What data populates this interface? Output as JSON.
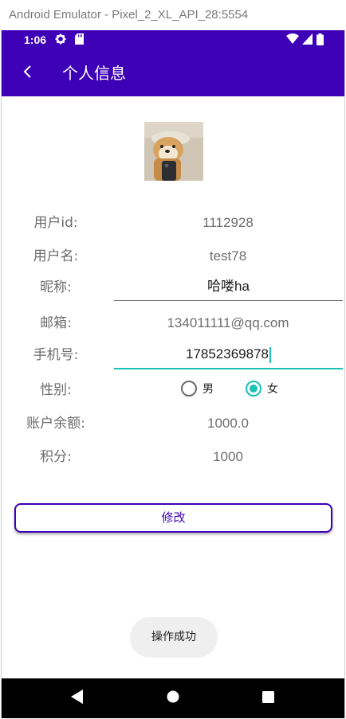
{
  "window": {
    "title": "Android Emulator - Pixel_2_XL_API_28:5554"
  },
  "status_bar": {
    "time": "1:06",
    "left_icons": [
      "gear-icon",
      "sd-card-icon"
    ],
    "right_icons": [
      "wifi-icon",
      "signal-icon",
      "battery-icon"
    ]
  },
  "app_bar": {
    "title": "个人信息",
    "back_icon": "back-arrow-icon"
  },
  "avatar": {
    "description": "dog-with-hat-avatar"
  },
  "fields": {
    "user_id": {
      "label": "用户id:",
      "value": "1112928"
    },
    "username": {
      "label": "用户名:",
      "value": "test78"
    },
    "nickname": {
      "label": "昵称:",
      "value": "哈喽ha"
    },
    "email": {
      "label": "邮箱:",
      "value": "134011111@qq.com"
    },
    "phone": {
      "label": "手机号:",
      "value": "17852369878"
    },
    "gender": {
      "label": "性别:",
      "options": [
        {
          "label": "男",
          "checked": false
        },
        {
          "label": "女",
          "checked": true
        }
      ]
    },
    "balance": {
      "label": "账户余额:",
      "value": "1000.0"
    },
    "points": {
      "label": "积分:",
      "value": "1000"
    }
  },
  "actions": {
    "edit_label": "修改"
  },
  "toast": {
    "text": "操作成功"
  },
  "colors": {
    "primary": "#3D00B7",
    "accent": "#19C3B5"
  },
  "nav_bar": {
    "icons": [
      "back-triangle-icon",
      "home-circle-icon",
      "overview-square-icon"
    ]
  }
}
